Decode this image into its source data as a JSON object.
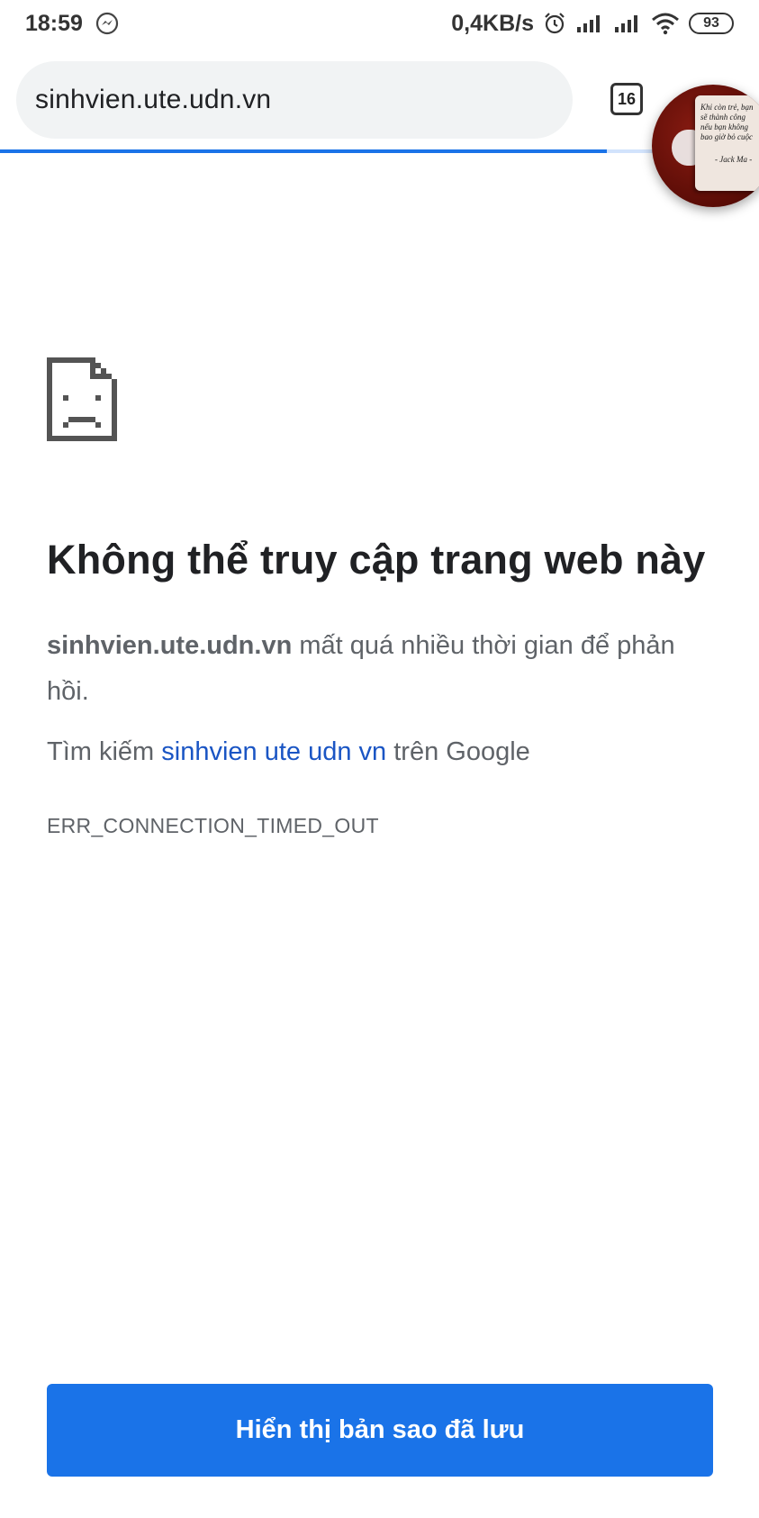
{
  "status_bar": {
    "time": "18:59",
    "notification_icon": "messenger-icon",
    "network_speed": "0,4KB/s",
    "icons": [
      "alarm-icon",
      "signal-icon",
      "signal-icon",
      "wifi-icon"
    ],
    "battery": "93"
  },
  "browser": {
    "url": "sinhvien.ute.udn.vn",
    "tab_count": "16",
    "load_progress": 0.8
  },
  "chat_bubble": {
    "text_lines": [
      "Khi còn trẻ, bạn",
      "sẽ thành công",
      "nếu bạn không",
      "bao giờ bỏ cuộc"
    ],
    "author": "- Jack Ma -"
  },
  "error": {
    "icon": "sad-page-icon",
    "title": "Không thể truy cập trang web này",
    "host": "sinhvien.ute.udn.vn",
    "description": " mất quá nhiều thời gian để phản hồi.",
    "search_prefix": "Tìm kiếm ",
    "search_query": "sinhvien ute udn vn",
    "search_suffix": " trên Google",
    "code": "ERR_CONNECTION_TIMED_OUT"
  },
  "actions": {
    "show_saved_copy": "Hiển thị bản sao đã lưu"
  },
  "colors": {
    "accent": "#1a73e8",
    "link": "#1a55c4",
    "text_secondary": "#5f6368"
  }
}
